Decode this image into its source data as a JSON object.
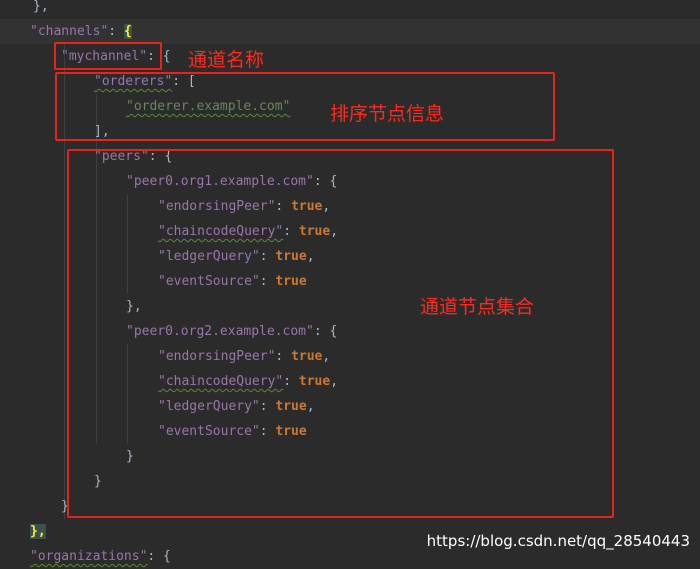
{
  "editor": {
    "tokens": {
      "t0": "},",
      "t1": "\"channels\"",
      "t1b": ": ",
      "t1c": "{",
      "t2": "\"mychannel\"",
      "t2b": ": {",
      "t3": "\"orderers\"",
      "t3b": ": [",
      "t4": "\"orderer.example.com\"",
      "t5": "],",
      "t6": "\"peers\"",
      "t6b": ": {",
      "t7": "\"peer0.org1.example.com\"",
      "t7b": ": {",
      "t8": "\"endorsingPeer\"",
      "t8b": ": ",
      "t8c": "true",
      "t8d": ",",
      "t9": "\"chaincodeQuery\"",
      "t9b": ": ",
      "t9c": "true",
      "t9d": ",",
      "t10": "\"ledgerQuery\"",
      "t10b": ": ",
      "t10c": "true",
      "t10d": ",",
      "t11": "\"eventSource\"",
      "t11b": ": ",
      "t11c": "true",
      "t12": "},",
      "t13": "\"peer0.org2.example.com\"",
      "t13b": ": {",
      "t14": "\"endorsingPeer\"",
      "t14b": ": ",
      "t14c": "true",
      "t14d": ",",
      "t15": "\"chaincodeQuery\"",
      "t15b": ": ",
      "t15c": "true",
      "t15d": ",",
      "t16": "\"ledgerQuery\"",
      "t16b": ": ",
      "t16c": "true",
      "t16d": ",",
      "t17": "\"eventSource\"",
      "t17b": ": ",
      "t17c": "true",
      "t18": "}",
      "t19": "}",
      "t20": "}",
      "t21": "},",
      "t22": "\"organizations\"",
      "t22b": ": {"
    }
  },
  "annotations": {
    "channel_name": "通道名称",
    "orderer_info": "排序节点信息",
    "peer_set": "通道节点集合"
  },
  "watermark": "https://blog.csdn.net/qq_28540443",
  "colors": {
    "background": "#2b2b2b",
    "key": "#9876aa",
    "string": "#6a8759",
    "keyword": "#cc7832",
    "annotation": "#e8231c"
  }
}
